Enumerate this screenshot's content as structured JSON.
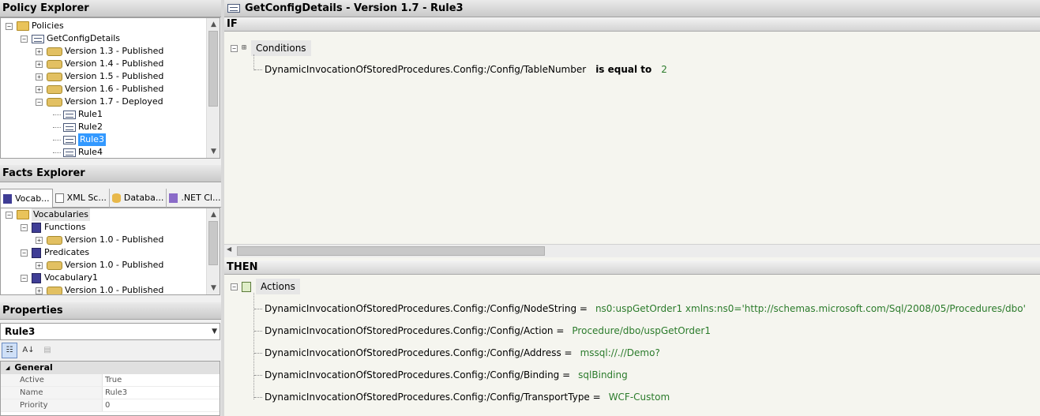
{
  "policy_explorer": {
    "title": "Policy Explorer",
    "items": [
      {
        "label": "Policies",
        "expander": "−"
      },
      {
        "label": "GetConfigDetails",
        "expander": "−"
      },
      {
        "label": "Version 1.3 - Published",
        "expander": "+"
      },
      {
        "label": "Version 1.4 - Published",
        "expander": "+"
      },
      {
        "label": "Version 1.5 - Published",
        "expander": "+"
      },
      {
        "label": "Version 1.6 - Published",
        "expander": "+"
      },
      {
        "label": "Version 1.7 - Deployed",
        "expander": "−"
      },
      {
        "label": "Rule1"
      },
      {
        "label": "Rule2"
      },
      {
        "label": "Rule3"
      },
      {
        "label": "Rule4"
      }
    ]
  },
  "facts_explorer": {
    "title": "Facts Explorer",
    "tabs": [
      {
        "label": "Vocab...",
        "icon": "vocabulary-book-icon"
      },
      {
        "label": "XML Sc...",
        "icon": "xml-schema-icon"
      },
      {
        "label": "Databa...",
        "icon": "database-icon"
      },
      {
        "label": ".NET Cl...",
        "icon": "dotnet-class-icon"
      }
    ],
    "items": [
      {
        "label": "Vocabularies",
        "expander": "−"
      },
      {
        "label": "Functions",
        "expander": "−"
      },
      {
        "label": "Version 1.0 - Published",
        "expander": "+"
      },
      {
        "label": "Predicates",
        "expander": "−"
      },
      {
        "label": "Version 1.0 - Published",
        "expander": "+"
      },
      {
        "label": "Vocabulary1",
        "expander": "−"
      },
      {
        "label": "Version 1.0 - Published",
        "expander": "+"
      }
    ]
  },
  "properties": {
    "title": "Properties",
    "selected_object": "Rule3",
    "category": "General",
    "category_expander": "◢",
    "rows": [
      {
        "name": "Active",
        "value": "True"
      },
      {
        "name": "Name",
        "value": "Rule3"
      },
      {
        "name": "Priority",
        "value": "0"
      }
    ]
  },
  "editor": {
    "title": "GetConfigDetails - Version 1.7 - Rule3",
    "if_label": "IF",
    "conditions_label": "Conditions",
    "condition": {
      "fact": "DynamicInvocationOfStoredProcedures.Config:/Config/TableNumber",
      "operator": "is equal to",
      "value": "2"
    },
    "then_label": "THEN",
    "actions_label": "Actions",
    "actions": [
      {
        "target": "DynamicInvocationOfStoredProcedures.Config:/Config/NodeString =",
        "value": "ns0:uspGetOrder1 xmlns:ns0='http://schemas.microsoft.com/Sql/2008/05/Procedures/dbo'"
      },
      {
        "target": "DynamicInvocationOfStoredProcedures.Config:/Config/Action =",
        "value": "Procedure/dbo/uspGetOrder1"
      },
      {
        "target": "DynamicInvocationOfStoredProcedures.Config:/Config/Address =",
        "value": "mssql://.//Demo?"
      },
      {
        "target": "DynamicInvocationOfStoredProcedures.Config:/Config/Binding =",
        "value": "sqlBinding"
      },
      {
        "target": "DynamicInvocationOfStoredProcedures.Config:/Config/TransportType =",
        "value": "WCF-Custom"
      }
    ]
  },
  "glyphs": {
    "collapse": "−",
    "expand": "+",
    "up": "▲",
    "down": "▼",
    "left": "◀",
    "dropdown": "▼",
    "categorized": "☷",
    "alphabetical": "A↓",
    "property_pages": "▤"
  },
  "colors": {
    "selection": "#3399ff",
    "value_green": "#2b7b2b",
    "header_gray": "#c9c9c9"
  }
}
